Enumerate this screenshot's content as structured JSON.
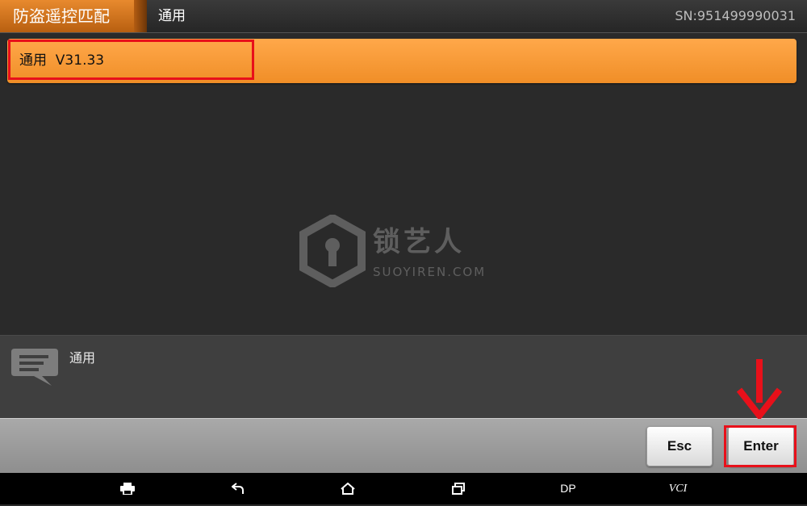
{
  "header": {
    "title": "防盗遥控匹配",
    "breadcrumb": "通用",
    "serial": "SN:951499990031"
  },
  "list": {
    "items": [
      {
        "label": "通用  V31.33"
      }
    ]
  },
  "watermark": {
    "brand": "锁艺人",
    "domain": "SUOYIREN.COM"
  },
  "message": {
    "text": "通用"
  },
  "buttons": {
    "esc": "Esc",
    "enter": "Enter"
  },
  "navbar": {
    "dp": "DP",
    "vci": "VCI"
  },
  "colors": {
    "accent_orange": "#f5962f",
    "highlight_red": "#e8101a"
  },
  "icons": {
    "print": "print-icon",
    "back": "back-icon",
    "home": "home-icon",
    "recents": "recents-icon",
    "message": "chat-bubble-icon",
    "pointer": "down-arrow-icon"
  }
}
